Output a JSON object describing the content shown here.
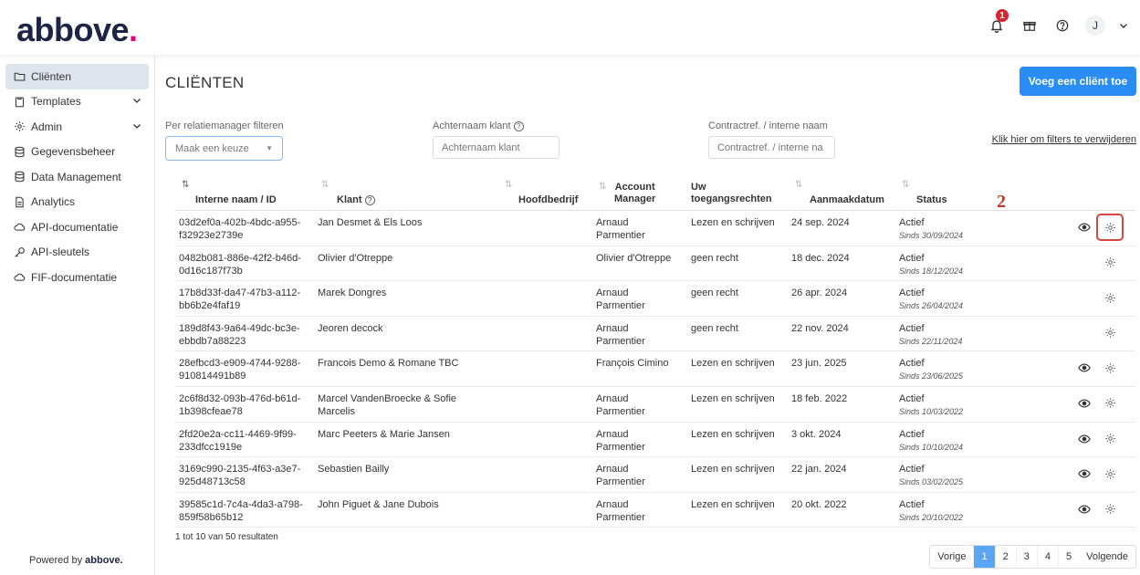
{
  "brand": {
    "name": "abbove",
    "dot": "."
  },
  "topbar": {
    "notifications_count": "1",
    "avatar_initial": "J"
  },
  "sidebar": {
    "items": [
      {
        "label": "Cliënten",
        "icon": "folder-icon",
        "active": true,
        "expandable": false
      },
      {
        "label": "Templates",
        "icon": "clipboard-icon",
        "active": false,
        "expandable": true
      },
      {
        "label": "Admin",
        "icon": "gear-icon",
        "active": false,
        "expandable": true
      },
      {
        "label": "Gegevensbeheer",
        "icon": "database-icon",
        "active": false,
        "expandable": false
      },
      {
        "label": "Data Management",
        "icon": "database-icon",
        "active": false,
        "expandable": false
      },
      {
        "label": "Analytics",
        "icon": "document-icon",
        "active": false,
        "expandable": false
      },
      {
        "label": "API-documentatie",
        "icon": "cloud-icon",
        "active": false,
        "expandable": false
      },
      {
        "label": "API-sleutels",
        "icon": "key-icon",
        "active": false,
        "expandable": false
      },
      {
        "label": "FIF-documentatie",
        "icon": "cloud-icon",
        "active": false,
        "expandable": false
      }
    ],
    "powered_prefix": "Powered by",
    "powered_brand": "abbove."
  },
  "main": {
    "title": "CLIËNTEN",
    "add_button": "Voeg een cliënt toe",
    "filters": {
      "manager_label": "Per relatiemanager filteren",
      "manager_value": "Maak een keuze",
      "lastname_label": "Achternaam klant",
      "lastname_placeholder": "Achternaam klant",
      "contract_label": "Contractref. / interne naam",
      "contract_placeholder": "Contractref. / interne na",
      "clear_link": "Klik hier om filters te verwijderen"
    },
    "columns": {
      "id": "Interne naam / ID",
      "client": "Klant",
      "company": "Hoofdbedrijf",
      "manager_1": "Account",
      "manager_2": "Manager",
      "rights_1": "Uw",
      "rights_2": "toegangsrechten",
      "created": "Aanmaakdatum",
      "status": "Status"
    },
    "annotation": "2",
    "rows": [
      {
        "id1": "03d2ef0a-402b-4bdc-a955-",
        "id2": "f32923e2739e",
        "client1": "Jan Desmet & Els Loos",
        "client2": "",
        "company": "",
        "manager1": "Arnaud",
        "manager2": "Parmentier",
        "rights": "Lezen en schrijven",
        "created": "24 sep. 2024",
        "status": "Actief",
        "since": "Sinds 30/09/2024",
        "view": true,
        "highlight": true
      },
      {
        "id1": "0482b081-886e-42f2-b46d-",
        "id2": "0d16c187f73b",
        "client1": "Olivier d'Otreppe",
        "client2": "",
        "company": "",
        "manager1": "Olivier d'Otreppe",
        "manager2": "",
        "rights": "geen recht",
        "created": "18 dec. 2024",
        "status": "Actief",
        "since": "Sinds 18/12/2024",
        "view": false,
        "highlight": false
      },
      {
        "id1": "17b8d33f-da47-47b3-a112-",
        "id2": "bb6b2e4faf19",
        "client1": "Marek Dongres",
        "client2": "",
        "company": "",
        "manager1": "Arnaud",
        "manager2": "Parmentier",
        "rights": "geen recht",
        "created": "26 apr. 2024",
        "status": "Actief",
        "since": "Sinds 26/04/2024",
        "view": false,
        "highlight": false
      },
      {
        "id1": "189d8f43-9a64-49dc-bc3e-",
        "id2": "ebbdb7a88223",
        "client1": "Jeoren decock",
        "client2": "",
        "company": "",
        "manager1": "Arnaud",
        "manager2": "Parmentier",
        "rights": "geen recht",
        "created": "22 nov. 2024",
        "status": "Actief",
        "since": "Sinds 22/11/2024",
        "view": false,
        "highlight": false
      },
      {
        "id1": "28efbcd3-e909-4744-9288-",
        "id2": "910814491b89",
        "client1": "Francois Demo & Romane TBC",
        "client2": "",
        "company": "",
        "manager1": "François Cimino",
        "manager2": "",
        "rights": "Lezen en schrijven",
        "created": "23 jun. 2025",
        "status": "Actief",
        "since": "Sinds 23/06/2025",
        "view": true,
        "highlight": false
      },
      {
        "id1": "2c6f8d32-093b-476d-b61d-",
        "id2": "1b398cfeae78",
        "client1": "Marcel VandenBroecke & Sofie",
        "client2": "Marcelis",
        "company": "",
        "manager1": "Arnaud",
        "manager2": "Parmentier",
        "rights": "Lezen en schrijven",
        "created": "18 feb. 2022",
        "status": "Actief",
        "since": "Sinds 10/03/2022",
        "view": true,
        "highlight": false
      },
      {
        "id1": "2fd20e2a-cc11-4469-9f99-",
        "id2": "233dfcc1919e",
        "client1": "Marc Peeters & Marie Jansen",
        "client2": "",
        "company": "",
        "manager1": "Arnaud",
        "manager2": "Parmentier",
        "rights": "Lezen en schrijven",
        "created": "3 okt. 2024",
        "status": "Actief",
        "since": "Sinds 10/10/2024",
        "view": true,
        "highlight": false
      },
      {
        "id1": "3169c990-2135-4f63-a3e7-",
        "id2": "925d48713c58",
        "client1": "Sebastien Bailly",
        "client2": "",
        "company": "",
        "manager1": "Arnaud",
        "manager2": "Parmentier",
        "rights": "Lezen en schrijven",
        "created": "22 jan. 2024",
        "status": "Actief",
        "since": "Sinds 03/02/2025",
        "view": true,
        "highlight": false
      },
      {
        "id1": "39585c1d-7c4a-4da3-a798-",
        "id2": "859f58b65b12",
        "client1": "John Piguet & Jane Dubois",
        "client2": "",
        "company": "",
        "manager1": "Arnaud",
        "manager2": "Parmentier",
        "rights": "Lezen en schrijven",
        "created": "20 okt. 2022",
        "status": "Actief",
        "since": "Sinds 20/10/2022",
        "view": true,
        "highlight": false
      }
    ],
    "result_count": "1 tot 10 van 50 resultaten",
    "pagination": {
      "prev": "Vorige",
      "pages": [
        "1",
        "2",
        "3",
        "4",
        "5"
      ],
      "active": "1",
      "next": "Volgende"
    }
  }
}
